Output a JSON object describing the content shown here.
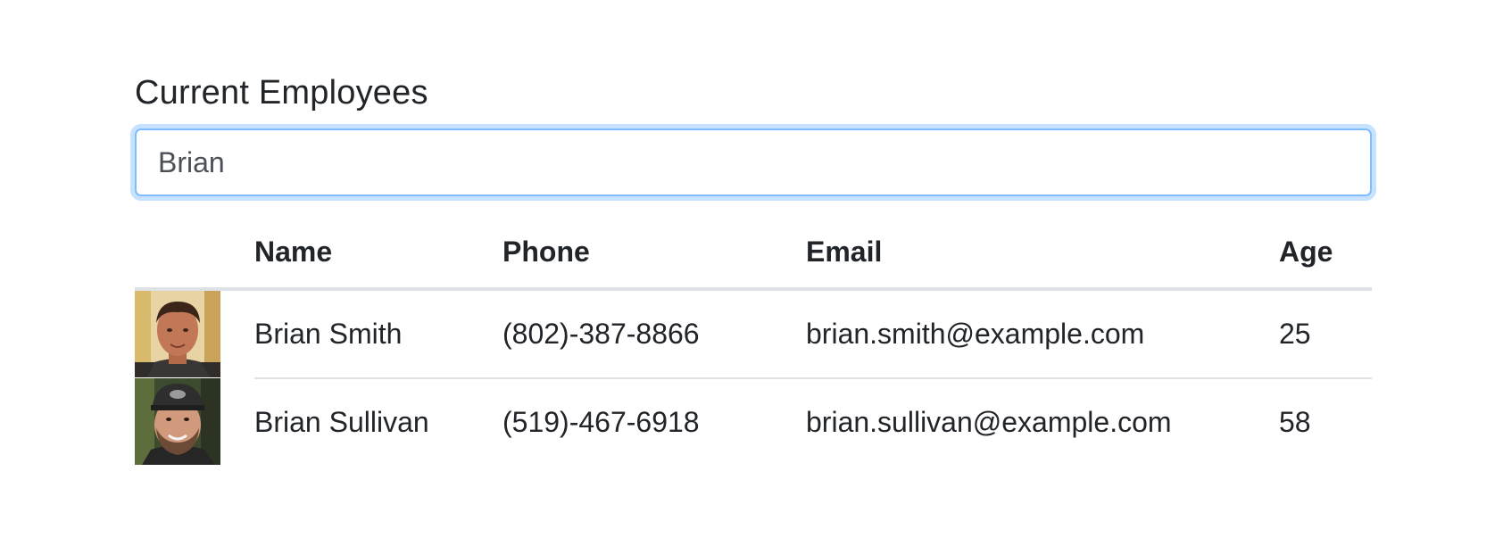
{
  "page": {
    "title": "Current Employees"
  },
  "search": {
    "value": "Brian",
    "placeholder": ""
  },
  "table": {
    "headers": {
      "photo": "",
      "name": "Name",
      "phone": "Phone",
      "email": "Email",
      "age": "Age"
    },
    "rows": [
      {
        "avatar": "employee-photo",
        "name": "Brian Smith",
        "phone": "(802)-387-8866",
        "email": "brian.smith@example.com",
        "age": "25"
      },
      {
        "avatar": "employee-photo",
        "name": "Brian Sullivan",
        "phone": "(519)-467-6918",
        "email": "brian.sullivan@example.com",
        "age": "58"
      }
    ]
  },
  "colors": {
    "focus_border": "#80bdff",
    "text": "#212529",
    "divider": "#dee2e6"
  }
}
